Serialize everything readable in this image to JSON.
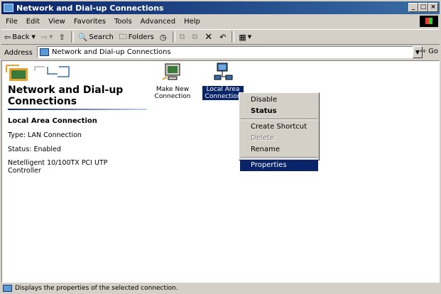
{
  "window": {
    "title": "Network and Dial-up Connections",
    "buttons": [
      "_",
      "□",
      "×"
    ]
  },
  "menubar": {
    "items": [
      {
        "label": "File"
      },
      {
        "label": "Edit"
      },
      {
        "label": "View"
      },
      {
        "label": "Favorites"
      },
      {
        "label": "Tools"
      },
      {
        "label": "Advanced"
      },
      {
        "label": "Help"
      }
    ]
  },
  "toolbar": {
    "back_label": "Back",
    "search_label": "Search",
    "folders_label": "Folders"
  },
  "address": {
    "label": "Address",
    "value": "Network and Dial-up Connections",
    "go_label": "Go"
  },
  "panel": {
    "title_line1": "Network and Dial-up",
    "title_line2": "Connections",
    "subtitle": "Local Area Connection",
    "type": "Type: LAN Connection",
    "status": "Status: Enabled",
    "device_line1": "Netelligent 10/100TX PCI UTP",
    "device_line2": "Controller"
  },
  "icons": [
    {
      "label_line1": "Make New",
      "label_line2": "Connection"
    },
    {
      "label_line1": "Local Area",
      "label_line2": "Connection"
    }
  ],
  "context_menu": {
    "disable": "Disable",
    "status": "Status",
    "create_shortcut": "Create Shortcut",
    "delete": "Delete",
    "rename": "Rename",
    "properties": "Properties"
  },
  "statusbar": {
    "text": "Displays the properties of the selected connection."
  },
  "colors": {
    "titlebar": "#0a246a",
    "selection": "#0a246a",
    "face": "#d4d0c8"
  }
}
